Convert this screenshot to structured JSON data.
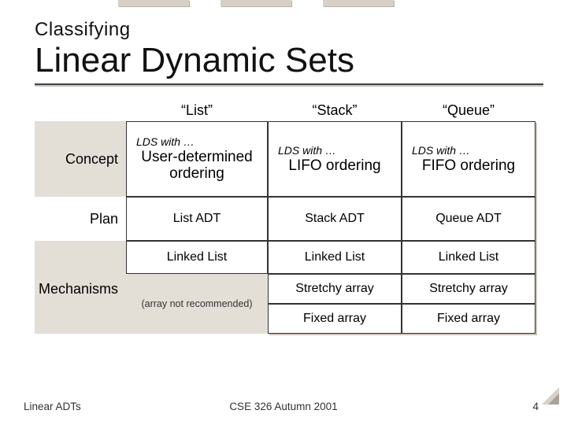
{
  "heading": {
    "kicker": "Classifying",
    "title": "Linear Dynamic Sets"
  },
  "columns": {
    "list": "“List”",
    "stack": "“Stack”",
    "queue": "“Queue”"
  },
  "rows": {
    "concept_label": "Concept",
    "plan_label": "Plan",
    "mechanisms_label": "Mechanisms"
  },
  "lds_prefix": "LDS with …",
  "concept": {
    "list": "User-determined ordering",
    "stack": "LIFO ordering",
    "queue": "FIFO ordering"
  },
  "plan": {
    "list": "List ADT",
    "stack": "Stack ADT",
    "queue": "Queue ADT"
  },
  "mech": {
    "linked": "Linked List",
    "stretchy": "Stretchy array",
    "fixed": "Fixed array",
    "list_note": "(array not recommended)"
  },
  "footer": {
    "left": "Linear ADTs",
    "center": "CSE 326 Autumn 2001",
    "right": "4"
  }
}
